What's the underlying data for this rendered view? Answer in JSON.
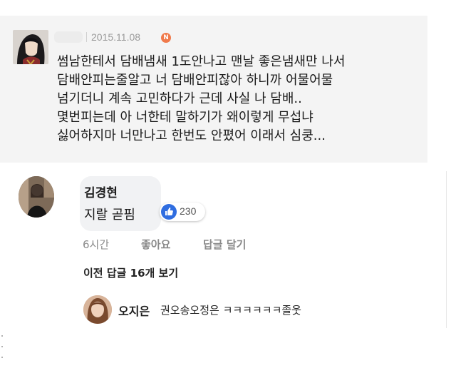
{
  "post": {
    "date": "2015.11.08",
    "new_badge": "N",
    "lines": [
      "썸남한테서 담배냄새 1도안나고 맨날 좋은냄새만 나서",
      "담배안피는줄알고 너 담배안피잖아 하니까 어물어물",
      "넘기더니 계속 고민하다가 근데 사실 나 담배..",
      "몇번피는데 아 너한테 말하기가 왜이렇게 무섭냐",
      "싫어하지마 너만나고 한번도 안폈어 이래서 심쿵..."
    ]
  },
  "comment": {
    "author": "김경현",
    "text": "지랄 곧핌",
    "like_count": "230",
    "time": "6시간",
    "like_label": "좋아요",
    "reply_label": "답글 달기",
    "previous_replies": "이전 답글 16개 보기"
  },
  "reply": {
    "author": "오지은",
    "text": "권오송오정은 ㅋㅋㅋㅋㅋㅋ졸웃"
  },
  "colors": {
    "post_background": "#f4f4f4",
    "bubble_background": "#f1f2f4",
    "like_blue": "#2f6de0",
    "new_badge": "#f07a4b"
  }
}
